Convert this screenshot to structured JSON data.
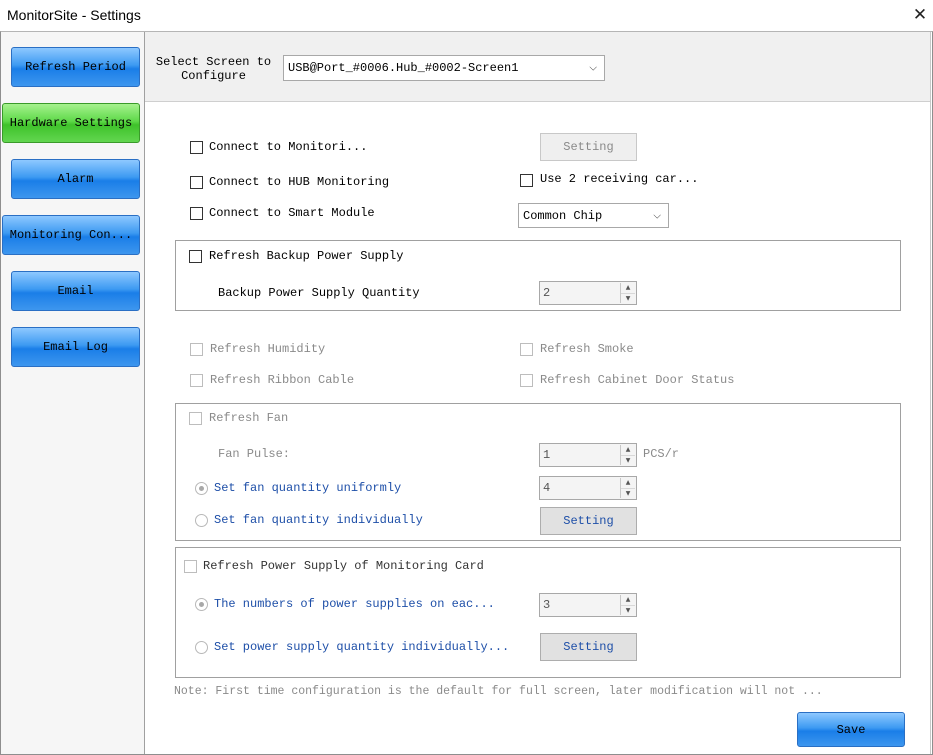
{
  "window": {
    "title": "MonitorSite - Settings",
    "close_glyph": "✕"
  },
  "sidebar": {
    "items": [
      {
        "label": "Refresh Period"
      },
      {
        "label": "Hardware Settings"
      },
      {
        "label": "Alarm"
      },
      {
        "label": "Monitoring Con..."
      },
      {
        "label": "Email"
      },
      {
        "label": "Email Log"
      }
    ],
    "active_index": 1
  },
  "header": {
    "select_label_line1": "Select Screen to",
    "select_label_line2": "Configure",
    "screen_value": "USB@Port_#0006.Hub_#0002-Screen1"
  },
  "hardware": {
    "connect_monitoring": "Connect to Monitori...",
    "setting_btn": "Setting",
    "connect_hub": "Connect to HUB Monitoring",
    "use_two_cards": "Use 2 receiving car...",
    "connect_smart": "Connect to Smart Module",
    "chip_value": "Common Chip",
    "refresh_backup": "Refresh Backup Power Supply",
    "backup_qty_label": "Backup Power Supply Quantity",
    "backup_qty_value": "2",
    "refresh_humidity": "Refresh Humidity",
    "refresh_smoke": "Refresh Smoke",
    "refresh_ribbon": "Refresh Ribbon Cable",
    "refresh_cabinet": "Refresh Cabinet Door Status",
    "refresh_fan": "Refresh Fan",
    "fan_pulse_label": "Fan Pulse:",
    "fan_pulse_value": "1",
    "fan_pulse_unit": "PCS/r",
    "fan_uniform": "Set fan quantity uniformly",
    "fan_uniform_value": "4",
    "fan_individual": "Set fan quantity individually",
    "fan_setting_btn": "Setting",
    "refresh_power_card": "Refresh Power Supply of Monitoring Card",
    "power_each": "The numbers of power supplies on eac...",
    "power_each_value": "3",
    "power_individual": "Set power supply quantity individually...",
    "power_setting_btn": "Setting"
  },
  "footer": {
    "note": "Note: First time configuration is the default for full screen, later modification will not ...",
    "save_label": "Save"
  },
  "colors": {
    "nav_blue": "#3d9af2",
    "nav_active_green": "#5fd94a",
    "link_blue": "#1e4fa8"
  }
}
